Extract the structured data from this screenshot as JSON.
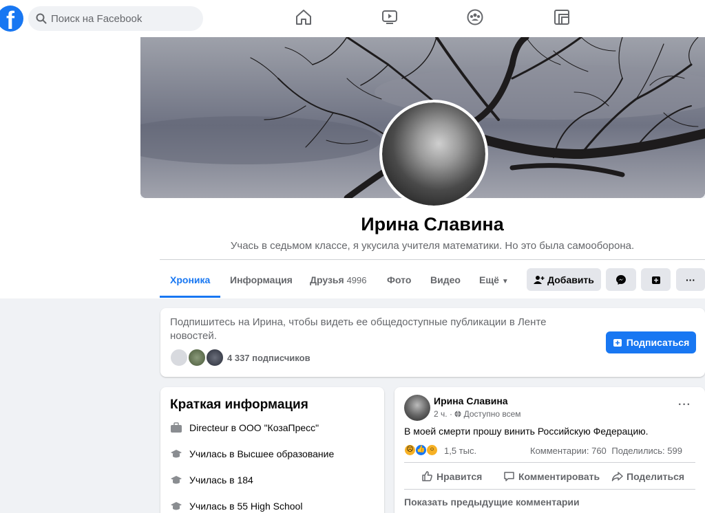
{
  "search": {
    "placeholder": "Поиск на Facebook"
  },
  "nav": {
    "icons": [
      "home-icon",
      "watch-icon",
      "groups-icon",
      "gaming-icon"
    ]
  },
  "profile": {
    "name": "Ирина Славина",
    "bio": "Учась в седьмом классе, я укусила учителя математики. Но это была самооборона."
  },
  "tabs": {
    "timeline": "Хроника",
    "about": "Информация",
    "friends": "Друзья",
    "friends_count": "4996",
    "photos": "Фото",
    "video": "Видео",
    "more": "Ещё"
  },
  "actions": {
    "add": "Добавить",
    "more_glyph": "···"
  },
  "subscribe": {
    "text": "Подпишитесь на Ирина, чтобы видеть ее общедоступные публикации в Ленте новостей.",
    "followers": "4 337 подписчиков",
    "button": "Подписаться"
  },
  "intro": {
    "title": "Краткая информация",
    "items": [
      "Directeur в ООО \"КозаПресс\"",
      "Училась в Высшее образование",
      "Училась в 184",
      "Училась в 55 High School"
    ]
  },
  "post": {
    "author": "Ирина Славина",
    "time": "2 ч.",
    "audience": "Доступно всем",
    "text": "В моей смерти прошу винить Российскую Федерацию.",
    "reactions_count": "1,5 тыс.",
    "comments": "Комментарии: 760",
    "shares": "Поделились: 599",
    "like": "Нравится",
    "comment": "Комментировать",
    "share": "Поделиться",
    "show_previous": "Показать предыдущие комментарии",
    "more_glyph": "···"
  },
  "colors": {
    "brand": "#1877f2",
    "secondary_text": "#65676b",
    "button_gray": "#e4e6eb"
  }
}
